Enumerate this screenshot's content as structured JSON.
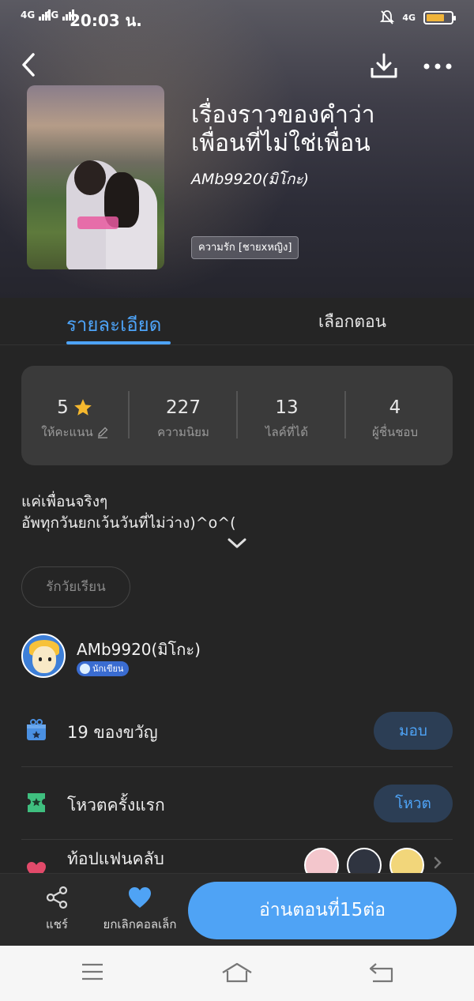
{
  "status_bar": {
    "sim1": "4G",
    "sim2": "4G",
    "time": "20:03 น.",
    "net_right": "4G"
  },
  "header": {
    "title_line1": "เรื่องราวของคำว่า",
    "title_line2": "เพื่อนที่ไม่ใช่เพื่อน",
    "author": "AMb9920(มิโกะ)",
    "tag": "ความรัก [ชายxหญิง]",
    "icons": [
      "back-arrow-icon",
      "download-icon",
      "more-icon"
    ]
  },
  "tabs": {
    "detail": "รายละเอียด",
    "episodes": "เลือกตอน"
  },
  "stats": {
    "rating_value": "5",
    "rating_label": "ให้คะแนน",
    "popularity_value": "227",
    "popularity_label": "ความนิยม",
    "likes_value": "13",
    "likes_label": "ไลค์ที่ได้",
    "fans_value": "4",
    "fans_label": "ผู้ชื่นชอบ"
  },
  "description": {
    "line1": "แค่เพื่อนจริงๆ",
    "line2": "อัพทุกวันยกเว้นวันที่ไม่ว่าง)^o^("
  },
  "genre_chip": "รักวัยเรียน",
  "author_card": {
    "name": "AMb9920(มิโกะ)",
    "badge": "นักเขียน"
  },
  "gift_row": {
    "label": "19 ของขวัญ",
    "button": "มอบ"
  },
  "vote_row": {
    "label": "โหวตครั้งแรก",
    "button": "โหวต"
  },
  "fan_row": {
    "label": "ท้อปแฟนคลับ"
  },
  "bottom_bar": {
    "share": "แชร์",
    "favorite": "ยกเลิกคอลเล็ก",
    "read": "อ่านตอนที่15ต่อ"
  },
  "colors": {
    "accent": "#4fa3f5",
    "background": "#252525",
    "card": "#3a3a3a",
    "star": "#f5b82e",
    "gift_icon": "#4a90e2",
    "vote_icon": "#3fbf7f",
    "heart": "#e24a6a"
  }
}
